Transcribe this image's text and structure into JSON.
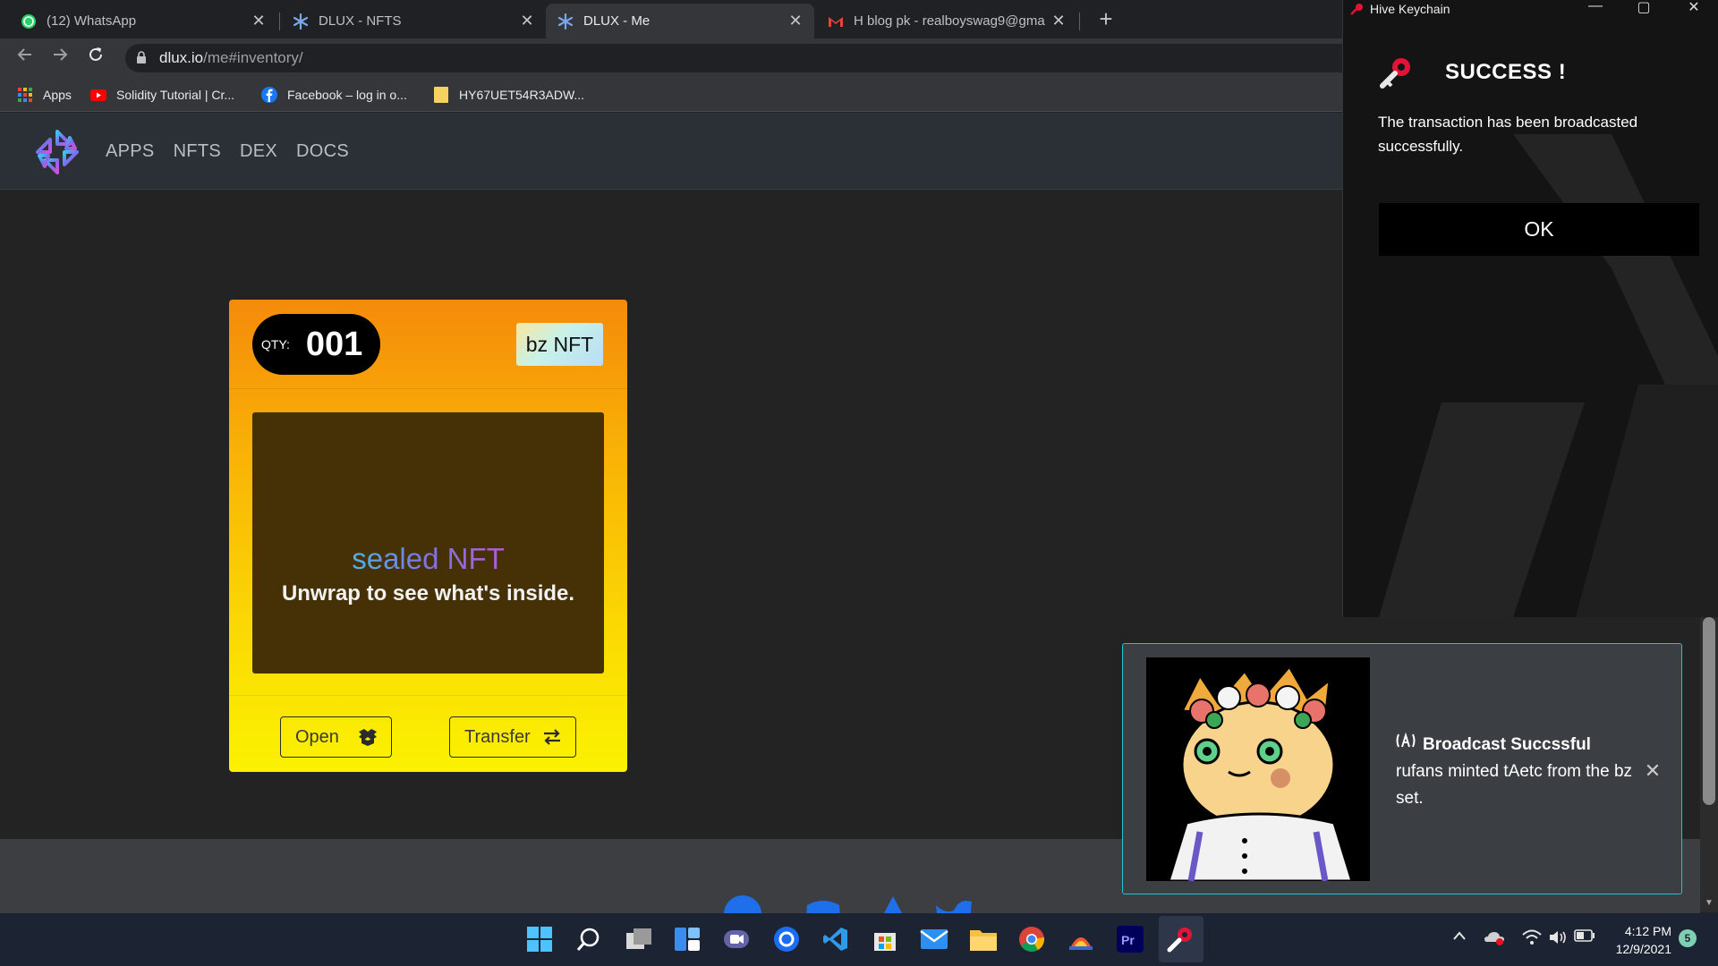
{
  "browser": {
    "tabs": [
      {
        "title": "(12) WhatsApp",
        "icon": "whatsapp-icon",
        "active": false
      },
      {
        "title": "DLUX - NFTS",
        "icon": "dlux-icon",
        "active": false
      },
      {
        "title": "DLUX - Me",
        "icon": "dlux-icon",
        "active": true
      },
      {
        "title": "H blog pk - realboyswag9@gmail.com",
        "icon": "gmail-icon",
        "active": false
      }
    ],
    "close_glyph": "✕",
    "new_tab_glyph": "+",
    "url_host": "dlux.io",
    "url_path": "/me#inventory/",
    "bookmarks": [
      {
        "label": "Apps",
        "icon": "apps-grid-icon"
      },
      {
        "label": "Solidity Tutorial | Cr...",
        "icon": "youtube-icon"
      },
      {
        "label": "Facebook – log in o...",
        "icon": "facebook-icon"
      },
      {
        "label": "HY67UET54R3ADW...",
        "icon": "note-icon"
      }
    ]
  },
  "site": {
    "nav": [
      "APPS",
      "NFTS",
      "DEX",
      "DOCS"
    ]
  },
  "nft_card": {
    "qty_label": "QTY:",
    "qty_value": "001",
    "set_badge": "bz NFT",
    "sealed_title": "sealed NFT",
    "sealed_subtitle": "Unwrap to see what's inside.",
    "open_label": "Open",
    "transfer_label": "Transfer"
  },
  "keychain": {
    "window_title": "Hive Keychain",
    "heading": "SUCCESS !",
    "message": "The transaction has been broadcasted successfully.",
    "ok_label": "OK"
  },
  "toast": {
    "title": "Broadcast Succssful",
    "message": "rufans minted tAetc from the bz set.",
    "close_glyph": "✕"
  },
  "taskbar": {
    "time": "4:12 PM",
    "date": "12/9/2021",
    "notification_count": "5"
  },
  "colors": {
    "card_top": "#f58a0b",
    "card_bottom": "#fbf200",
    "toast_border": "#19c5d6",
    "keychain_accent": "#e31337"
  }
}
